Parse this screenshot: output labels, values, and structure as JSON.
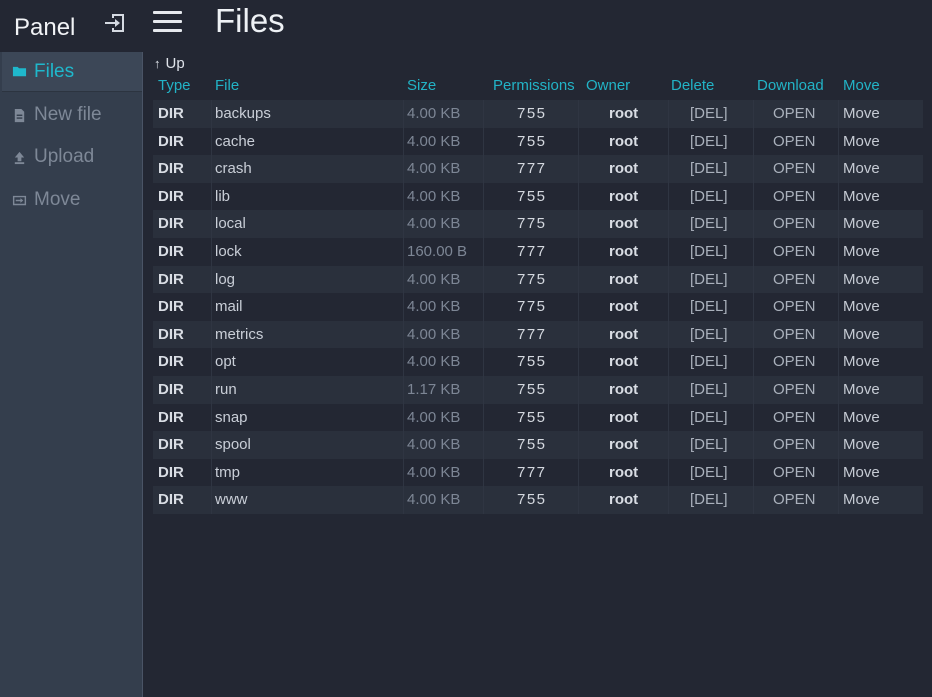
{
  "sidebar": {
    "brand": "Panel",
    "logout_icon": "logout-icon",
    "items": [
      {
        "label": "Files",
        "icon": "folder-icon",
        "active": true
      },
      {
        "label": "New file",
        "icon": "file-icon",
        "active": false
      },
      {
        "label": "Upload",
        "icon": "upload-icon",
        "active": false
      },
      {
        "label": "Move",
        "icon": "move-icon",
        "active": false
      }
    ]
  },
  "header": {
    "menu_icon": "hamburger-icon",
    "title": "Files"
  },
  "table": {
    "up_label": "Up",
    "columns": [
      "Type",
      "File",
      "Size",
      "Permissions",
      "Owner",
      "Delete",
      "Download",
      "Move"
    ],
    "rows": [
      {
        "type": "DIR",
        "name": "backups",
        "size": "4.00 KB",
        "perm": "755",
        "owner": "root",
        "del": "[DEL]",
        "open": "OPEN",
        "move": "Move"
      },
      {
        "type": "DIR",
        "name": "cache",
        "size": "4.00 KB",
        "perm": "755",
        "owner": "root",
        "del": "[DEL]",
        "open": "OPEN",
        "move": "Move"
      },
      {
        "type": "DIR",
        "name": "crash",
        "size": "4.00 KB",
        "perm": "777",
        "owner": "root",
        "del": "[DEL]",
        "open": "OPEN",
        "move": "Move"
      },
      {
        "type": "DIR",
        "name": "lib",
        "size": "4.00 KB",
        "perm": "755",
        "owner": "root",
        "del": "[DEL]",
        "open": "OPEN",
        "move": "Move"
      },
      {
        "type": "DIR",
        "name": "local",
        "size": "4.00 KB",
        "perm": "775",
        "owner": "root",
        "del": "[DEL]",
        "open": "OPEN",
        "move": "Move"
      },
      {
        "type": "DIR",
        "name": "lock",
        "size": "160.00 B",
        "perm": "777",
        "owner": "root",
        "del": "[DEL]",
        "open": "OPEN",
        "move": "Move"
      },
      {
        "type": "DIR",
        "name": "log",
        "size": "4.00 KB",
        "perm": "775",
        "owner": "root",
        "del": "[DEL]",
        "open": "OPEN",
        "move": "Move"
      },
      {
        "type": "DIR",
        "name": "mail",
        "size": "4.00 KB",
        "perm": "775",
        "owner": "root",
        "del": "[DEL]",
        "open": "OPEN",
        "move": "Move"
      },
      {
        "type": "DIR",
        "name": "metrics",
        "size": "4.00 KB",
        "perm": "777",
        "owner": "root",
        "del": "[DEL]",
        "open": "OPEN",
        "move": "Move"
      },
      {
        "type": "DIR",
        "name": "opt",
        "size": "4.00 KB",
        "perm": "755",
        "owner": "root",
        "del": "[DEL]",
        "open": "OPEN",
        "move": "Move"
      },
      {
        "type": "DIR",
        "name": "run",
        "size": "1.17 KB",
        "perm": "755",
        "owner": "root",
        "del": "[DEL]",
        "open": "OPEN",
        "move": "Move"
      },
      {
        "type": "DIR",
        "name": "snap",
        "size": "4.00 KB",
        "perm": "755",
        "owner": "root",
        "del": "[DEL]",
        "open": "OPEN",
        "move": "Move"
      },
      {
        "type": "DIR",
        "name": "spool",
        "size": "4.00 KB",
        "perm": "755",
        "owner": "root",
        "del": "[DEL]",
        "open": "OPEN",
        "move": "Move"
      },
      {
        "type": "DIR",
        "name": "tmp",
        "size": "4.00 KB",
        "perm": "777",
        "owner": "root",
        "del": "[DEL]",
        "open": "OPEN",
        "move": "Move"
      },
      {
        "type": "DIR",
        "name": "www",
        "size": "4.00 KB",
        "perm": "755",
        "owner": "root",
        "del": "[DEL]",
        "open": "OPEN",
        "move": "Move"
      }
    ]
  },
  "colors": {
    "accent": "#1fb8cc",
    "background": "#232733",
    "sidebar": "#343e4d"
  }
}
